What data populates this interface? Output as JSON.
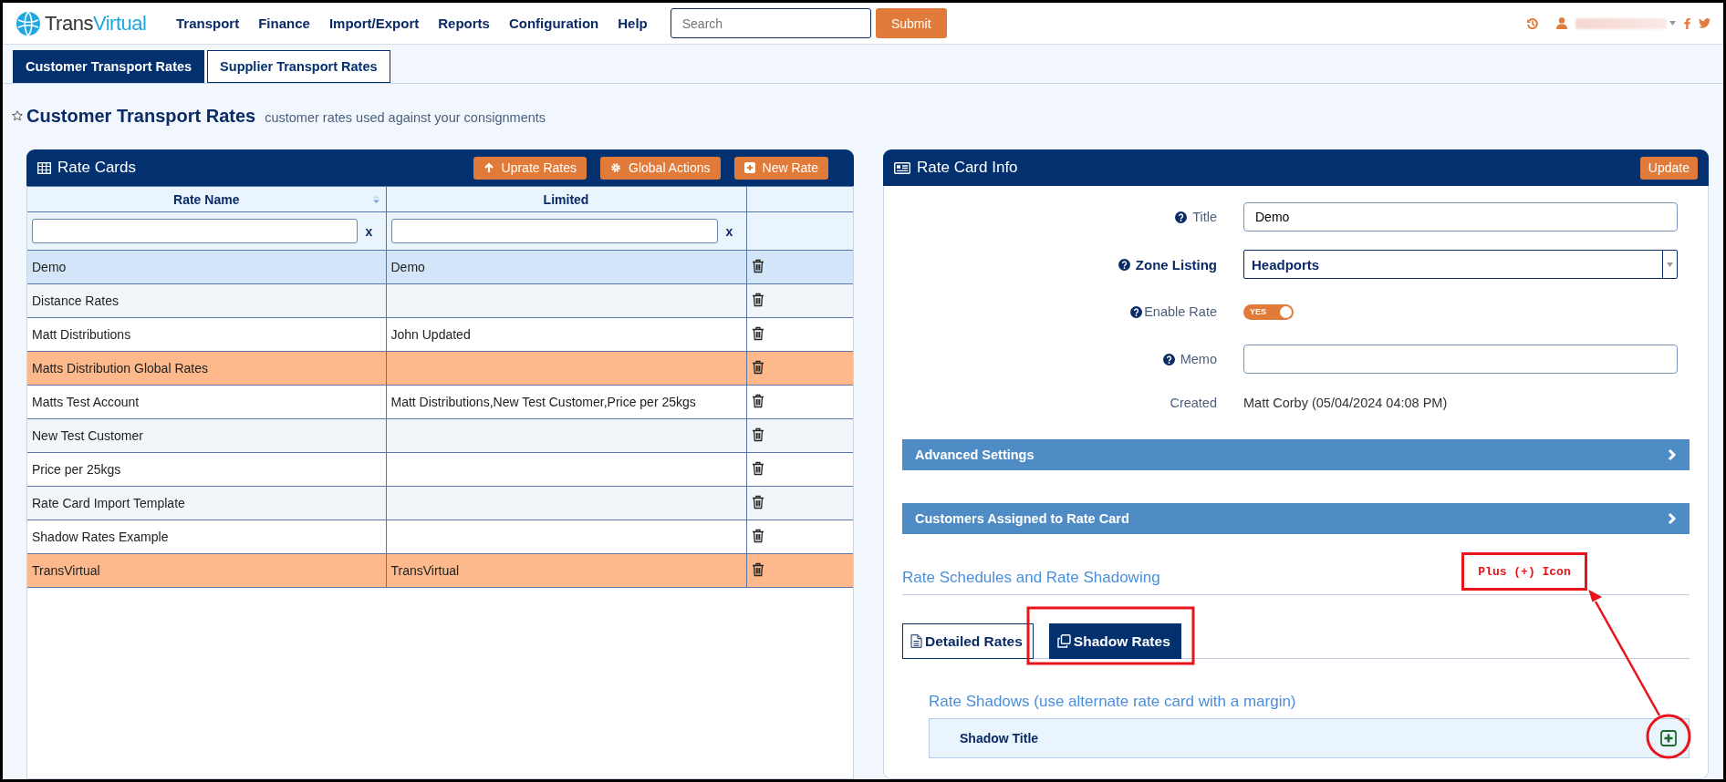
{
  "header": {
    "logo": {
      "part_1": "Trans",
      "part_2": "Virtual"
    },
    "nav": [
      "Transport",
      "Finance",
      "Import/Export",
      "Reports",
      "Configuration",
      "Help"
    ],
    "search": {
      "placeholder": "Search"
    },
    "submit": "Submit"
  },
  "tabs": [
    {
      "label": "Customer Transport Rates",
      "selected": true
    },
    {
      "label": "Supplier Transport Rates",
      "selected": false
    }
  ],
  "page": {
    "title": "Customer Transport Rates",
    "subtitle": "customer rates used against your consignments"
  },
  "rate_cards": {
    "title": "Rate Cards",
    "actions": [
      "Uprate Rates",
      "Global Actions",
      "New Rate"
    ],
    "columns": [
      "Rate Name",
      "Limited"
    ],
    "filters": [
      {
        "clear": "x"
      },
      {
        "clear": "x"
      }
    ],
    "rows": [
      {
        "rate_name": "Demo",
        "limited": "Demo",
        "selected": true,
        "highlighted": false
      },
      {
        "rate_name": "Distance Rates",
        "limited": "",
        "selected": false,
        "highlighted": false
      },
      {
        "rate_name": "Matt Distributions",
        "limited": "John Updated",
        "selected": false,
        "highlighted": false
      },
      {
        "rate_name": "Matts Distribution Global Rates",
        "limited": "",
        "selected": false,
        "highlighted": true
      },
      {
        "rate_name": "Matts Test Account",
        "limited": "Matt Distributions,New Test Customer,Price per 25kgs",
        "selected": false,
        "highlighted": false
      },
      {
        "rate_name": "New Test Customer",
        "limited": "",
        "selected": false,
        "highlighted": false
      },
      {
        "rate_name": "Price per 25kgs",
        "limited": "",
        "selected": false,
        "highlighted": false
      },
      {
        "rate_name": "Rate Card Import Template",
        "limited": "",
        "selected": false,
        "highlighted": false
      },
      {
        "rate_name": "Shadow Rates Example",
        "limited": "",
        "selected": false,
        "highlighted": false
      },
      {
        "rate_name": "TransVirtual",
        "limited": "TransVirtual",
        "selected": false,
        "highlighted": true
      }
    ]
  },
  "rate_card_info": {
    "title": "Rate Card Info",
    "update": "Update",
    "fields": [
      {
        "kind": "text",
        "label": "Title",
        "value": "Demo"
      },
      {
        "kind": "select",
        "label": "Zone Listing",
        "value": "Headports"
      },
      {
        "kind": "toggle",
        "label": "Enable Rate",
        "on": true,
        "on_label": "YES"
      },
      {
        "kind": "text",
        "label": "Memo"
      },
      {
        "kind": "static",
        "label": "Created",
        "value": "Matt Corby (05/04/2024 04:08 PM)"
      }
    ],
    "sections": [
      {
        "title": "Advanced Settings",
        "expanded": false
      },
      {
        "title": "Customers Assigned to Rate Card",
        "expanded": false
      }
    ],
    "schedules_title": "Rate Schedules and Rate Shadowing",
    "schedule_tabs": [
      {
        "label": "Detailed Rates",
        "selected": false
      },
      {
        "label": "Shadow Rates",
        "selected": true
      }
    ],
    "shadows": {
      "title": "Rate Shadows (use alternate rate card with a margin)",
      "column": "Shadow Title"
    }
  },
  "annotation": {
    "label": "Plus (+) Icon"
  }
}
